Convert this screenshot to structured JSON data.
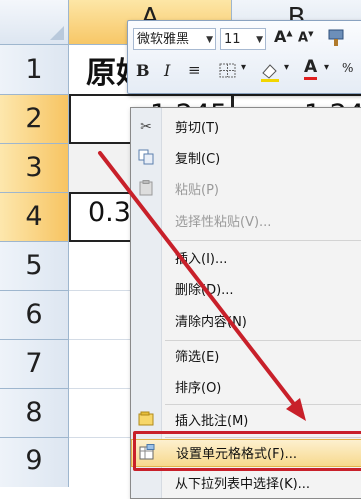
{
  "columns": {
    "a": "A",
    "b": "B"
  },
  "rows": [
    "1",
    "2",
    "3",
    "4",
    "5",
    "6",
    "7",
    "8",
    "9"
  ],
  "cells": {
    "a1": "原始",
    "a2": "1.245",
    "b2": "1.24",
    "a4": "0.3"
  },
  "mini_toolbar": {
    "font_name": "微软雅黑",
    "font_size": "11",
    "bold": "B",
    "italic": "I",
    "increase_font": "A",
    "decrease_font": "A",
    "font_color_letter": "A"
  },
  "context_menu": {
    "items": [
      {
        "label": "剪切(T)",
        "icon": "scissors-icon",
        "enabled": true
      },
      {
        "label": "复制(C)",
        "icon": "copy-icon",
        "enabled": true
      },
      {
        "label": "粘贴(P)",
        "icon": "paste-icon",
        "enabled": false
      },
      {
        "label": "选择性粘贴(V)...",
        "icon": "",
        "enabled": false
      },
      {
        "label": "插入(I)...",
        "icon": "",
        "enabled": true
      },
      {
        "label": "删除(D)...",
        "icon": "",
        "enabled": true
      },
      {
        "label": "清除内容(N)",
        "icon": "",
        "enabled": true
      },
      {
        "label": "筛选(E)",
        "icon": "",
        "enabled": true
      },
      {
        "label": "排序(O)",
        "icon": "",
        "enabled": true
      },
      {
        "label": "插入批注(M)",
        "icon": "comment-icon",
        "enabled": true
      },
      {
        "label": "设置单元格格式(F)...",
        "icon": "format-cells-icon",
        "enabled": true,
        "highlighted": true
      },
      {
        "label": "从下拉列表中选择(K)...",
        "icon": "",
        "enabled": true
      }
    ]
  },
  "annotation": {
    "arrow_color": "#c8202a",
    "box_color": "#c8202a"
  },
  "colors": {
    "selected_header": "#f7c767",
    "header": "#dde6f1",
    "highlight": "#f7d98e"
  }
}
